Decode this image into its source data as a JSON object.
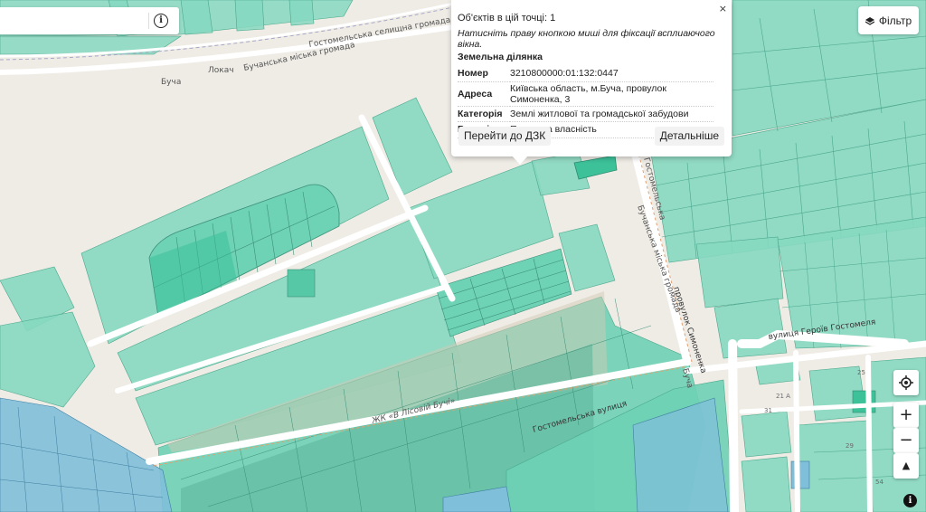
{
  "search": {
    "value": "",
    "placeholder": ""
  },
  "filter": {
    "label": "Фільтр",
    "icon": "layers-icon"
  },
  "popup": {
    "count": "Об'єктів в цій точці: 1",
    "hint": "Натисніть праву кнопкою миші для фіксації всплиаючого вікна.",
    "section_title": "Земельна ділянка",
    "rows": [
      {
        "key": "Номер",
        "value": "3210800000:01:132:0447"
      },
      {
        "key": "Адреса",
        "value": "Київська область, м.Буча, провулок Симоненка, 3"
      },
      {
        "key": "Категорія",
        "value": "Землі житлової та громадської забудови"
      },
      {
        "key": "Власність",
        "value": "Приватна власність"
      }
    ],
    "goto_button": "Перейти до ДЗК",
    "details_button": "Детальніше",
    "close": "×"
  },
  "map_labels": {
    "hostomel_hromada_top": "Гостомельська селищна громада",
    "bucha_hromada_top": "Бучанська міська громада",
    "lokach": "Локач",
    "bucha": "Буча",
    "bucha_hromada_vertical": "Бучанська міська громада",
    "hostomelska_vertical": "Гостомельська",
    "provulok": "провулок Симоненка",
    "vul_heroiv": "вулиця Героїв Гостомеля",
    "hostomelska_vulytsia": "Гостомельська вулиця",
    "zhk": "ЖК «В Лісовій Бучі»",
    "bucha_small": "Буча",
    "num_25": "25",
    "num_21a": "21 А",
    "num_31": "31",
    "num_29": "29",
    "num_54": "54"
  },
  "controls": {
    "locate_icon": "locate-icon",
    "zoom_in": "+",
    "zoom_out": "−",
    "compass": "▲",
    "attribution": "i"
  },
  "colors": {
    "parcel": "#6ed2b5",
    "parcel_dark": "#3cc199",
    "parcel_blue": "#7fbfd9",
    "road": "#ffffff",
    "background": "#efece6"
  }
}
